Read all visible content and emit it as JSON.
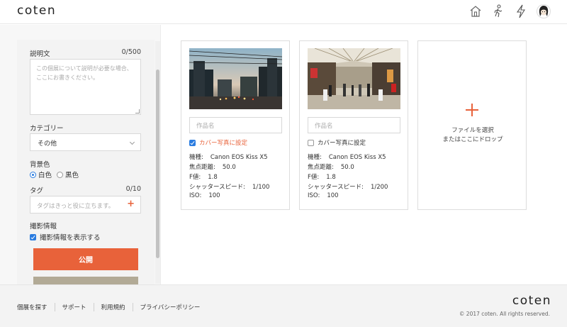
{
  "header": {
    "logo": "coten",
    "icons": [
      "home-icon",
      "walking-person-icon",
      "lightning-icon",
      "user-avatar-icon"
    ]
  },
  "sidebar": {
    "description_label": "説明文",
    "description_count": "0/500",
    "description_placeholder": "この個展について説明が必要な場合、ここにお書きください。",
    "category_label": "カテゴリー",
    "category_value": "その他",
    "background_label": "背景色",
    "background_options": [
      {
        "label": "白色",
        "selected": true
      },
      {
        "label": "黒色",
        "selected": false
      }
    ],
    "tag_label": "タグ",
    "tag_count": "0/10",
    "tag_placeholder": "タグはきっと役に立ちます。",
    "photo_info_label": "撮影情報",
    "photo_info_checkbox": "撮影情報を表示する",
    "publish_button": "公開"
  },
  "cards": [
    {
      "name_placeholder": "作品名",
      "cover_label": "カバー写真に設定",
      "cover_checked": true,
      "exif": [
        {
          "key": "機種:",
          "value": "Canon EOS Kiss X5"
        },
        {
          "key": "焦点距離:",
          "value": "50.0"
        },
        {
          "key": "F値:",
          "value": "1.8"
        },
        {
          "key": "シャッタースピード:",
          "value": "1/100"
        },
        {
          "key": "ISO:",
          "value": "100"
        }
      ]
    },
    {
      "name_placeholder": "作品名",
      "cover_label": "カバー写真に設定",
      "cover_checked": false,
      "exif": [
        {
          "key": "機種:",
          "value": "Canon EOS Kiss X5"
        },
        {
          "key": "焦点距離:",
          "value": "50.0"
        },
        {
          "key": "F値:",
          "value": "1.8"
        },
        {
          "key": "シャッタースピード:",
          "value": "1/200"
        },
        {
          "key": "ISO:",
          "value": "100"
        }
      ]
    }
  ],
  "upload": {
    "line1": "ファイルを選択",
    "line2": "またはここにドロップ"
  },
  "footer": {
    "links": [
      "個展を探す",
      "サポート",
      "利用規約",
      "プライバシーポリシー"
    ],
    "logo": "coten",
    "copyright": "© 2017 coten. All rights reserved."
  },
  "colors": {
    "accent": "#e8623a",
    "checkbox": "#2a7ce0",
    "secondary_button": "#b2aa96"
  }
}
